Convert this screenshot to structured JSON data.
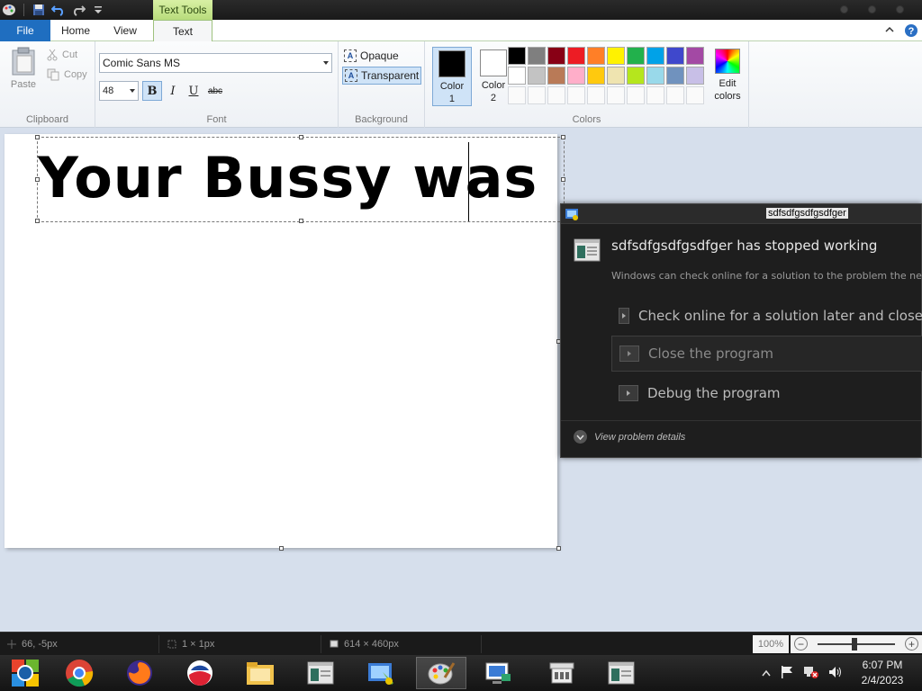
{
  "titlebar": {
    "context_tab": "Text Tools"
  },
  "tabs": {
    "file": "File",
    "home": "Home",
    "view": "View",
    "text": "Text"
  },
  "clipboard": {
    "paste": "Paste",
    "cut": "Cut",
    "copy": "Copy",
    "label": "Clipboard"
  },
  "font": {
    "family": "Comic Sans MS",
    "size": "48",
    "bold": "B",
    "italic": "I",
    "underline": "U",
    "strike": "abc",
    "label": "Font"
  },
  "background": {
    "opaque": "Opaque",
    "transparent": "Transparent",
    "glyph": "A",
    "label": "Background"
  },
  "colors": {
    "color1_label": "Color\n1",
    "color2_label": "Color\n2",
    "color1_value": "#000000",
    "color2_value": "#ffffff",
    "edit": "Edit colors",
    "label": "Colors",
    "palette_row1": [
      "#000000",
      "#7f7f7f",
      "#880015",
      "#ed1c24",
      "#ff7f27",
      "#fff200",
      "#22b14c",
      "#00a2e8",
      "#3f48cc",
      "#a349a4"
    ],
    "palette_row2": [
      "#ffffff",
      "#c3c3c3",
      "#b97a57",
      "#ffaec9",
      "#ffc90e",
      "#efe4b0",
      "#b5e61d",
      "#99d9ea",
      "#7092be",
      "#c8bfe7"
    ]
  },
  "canvas": {
    "text": "Your Bussy was"
  },
  "dialog": {
    "title": "sdfsdfgsdfgsdfger",
    "heading": "sdfsdfgsdfgsdfger has stopped working",
    "subtext": "Windows can check online for a solution to the problem the next tim",
    "option1": "Check online for a solution later and close",
    "option2": "Close the program",
    "option3": "Debug the program",
    "details": "View problem details"
  },
  "status": {
    "position": "66, -5px",
    "selection": "1 × 1px",
    "size": "614 × 460px",
    "zoom": "100%"
  },
  "clock": {
    "time": "6:07 PM",
    "date": "2/4/2023"
  }
}
